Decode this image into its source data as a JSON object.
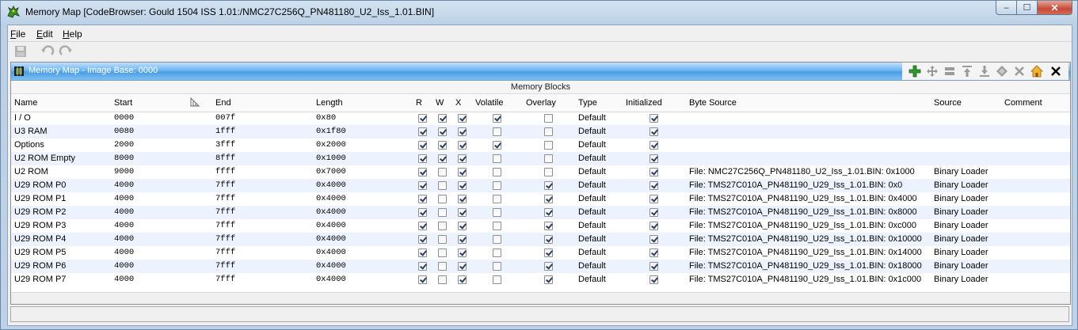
{
  "window": {
    "title": "Memory Map [CodeBrowser: Gould 1504 ISS 1.01:/NMC27C256Q_PN481180_U2_Iss_1.01.BIN]",
    "icon": "ghidra-dragon-icon",
    "buttons": {
      "minimize": "minimize-icon",
      "maximize": "maximize-icon",
      "close": "close-icon"
    }
  },
  "menu": [
    {
      "first": "F",
      "rest": "ile"
    },
    {
      "first": "E",
      "rest": "dit"
    },
    {
      "first": "H",
      "rest": "elp"
    }
  ],
  "toolbar": {
    "icons": [
      "save-icon",
      "undo-icon",
      "redo-icon"
    ]
  },
  "panel": {
    "title": "Memory Map - Image Base: 0000",
    "icon": "memory-chip-icon",
    "actions": [
      "add-block-icon",
      "move-block-icon",
      "split-block-icon",
      "expand-up-icon",
      "expand-down-icon",
      "merge-blocks-icon",
      "delete-block-icon",
      "set-image-base-icon",
      "close-panel-icon"
    ],
    "section_label": "Memory Blocks"
  },
  "table": {
    "columns": [
      "Name",
      "Start",
      "End",
      "Length",
      "R",
      "W",
      "X",
      "Volatile",
      "Overlay",
      "Type",
      "Initialized",
      "Byte Source",
      "Source",
      "Comment"
    ],
    "rows": [
      {
        "name": "I / O",
        "start": "0000",
        "end": "007f",
        "length": "0x80",
        "r": true,
        "w": true,
        "x": true,
        "volatile": true,
        "overlay": false,
        "type": "Default",
        "initialized": true,
        "byte_source": "",
        "source": "",
        "comment": ""
      },
      {
        "name": "U3 RAM",
        "start": "0080",
        "end": "1fff",
        "length": "0x1f80",
        "r": true,
        "w": true,
        "x": true,
        "volatile": false,
        "overlay": false,
        "type": "Default",
        "initialized": true,
        "byte_source": "",
        "source": "",
        "comment": ""
      },
      {
        "name": "Options",
        "start": "2000",
        "end": "3fff",
        "length": "0x2000",
        "r": true,
        "w": true,
        "x": true,
        "volatile": true,
        "overlay": false,
        "type": "Default",
        "initialized": true,
        "byte_source": "",
        "source": "",
        "comment": ""
      },
      {
        "name": "U2 ROM Empty",
        "start": "8000",
        "end": "8fff",
        "length": "0x1000",
        "r": true,
        "w": true,
        "x": true,
        "volatile": false,
        "overlay": false,
        "type": "Default",
        "initialized": true,
        "byte_source": "",
        "source": "",
        "comment": ""
      },
      {
        "name": "U2 ROM",
        "start": "9000",
        "end": "ffff",
        "length": "0x7000",
        "r": true,
        "w": false,
        "x": true,
        "volatile": false,
        "overlay": false,
        "type": "Default",
        "initialized": true,
        "byte_source": "File: NMC27C256Q_PN481180_U2_Iss_1.01.BIN: 0x1000",
        "source": "Binary Loader",
        "comment": ""
      },
      {
        "name": "U29 ROM P0",
        "start": "4000",
        "end": "7fff",
        "length": "0x4000",
        "r": true,
        "w": false,
        "x": true,
        "volatile": false,
        "overlay": true,
        "type": "Default",
        "initialized": true,
        "byte_source": "File: TMS27C010A_PN481190_U29_Iss_1.01.BIN: 0x0",
        "source": "Binary Loader",
        "comment": ""
      },
      {
        "name": "U29 ROM P1",
        "start": "4000",
        "end": "7fff",
        "length": "0x4000",
        "r": true,
        "w": false,
        "x": true,
        "volatile": false,
        "overlay": true,
        "type": "Default",
        "initialized": true,
        "byte_source": "File: TMS27C010A_PN481190_U29_Iss_1.01.BIN: 0x4000",
        "source": "Binary Loader",
        "comment": ""
      },
      {
        "name": "U29 ROM P2",
        "start": "4000",
        "end": "7fff",
        "length": "0x4000",
        "r": true,
        "w": false,
        "x": true,
        "volatile": false,
        "overlay": true,
        "type": "Default",
        "initialized": true,
        "byte_source": "File: TMS27C010A_PN481190_U29_Iss_1.01.BIN: 0x8000",
        "source": "Binary Loader",
        "comment": ""
      },
      {
        "name": "U29 ROM P3",
        "start": "4000",
        "end": "7fff",
        "length": "0x4000",
        "r": true,
        "w": false,
        "x": true,
        "volatile": false,
        "overlay": true,
        "type": "Default",
        "initialized": true,
        "byte_source": "File: TMS27C010A_PN481190_U29_Iss_1.01.BIN: 0xc000",
        "source": "Binary Loader",
        "comment": ""
      },
      {
        "name": "U29 ROM P4",
        "start": "4000",
        "end": "7fff",
        "length": "0x4000",
        "r": true,
        "w": false,
        "x": true,
        "volatile": false,
        "overlay": true,
        "type": "Default",
        "initialized": true,
        "byte_source": "File: TMS27C010A_PN481190_U29_Iss_1.01.BIN: 0x10000",
        "source": "Binary Loader",
        "comment": ""
      },
      {
        "name": "U29 ROM P5",
        "start": "4000",
        "end": "7fff",
        "length": "0x4000",
        "r": true,
        "w": false,
        "x": true,
        "volatile": false,
        "overlay": true,
        "type": "Default",
        "initialized": true,
        "byte_source": "File: TMS27C010A_PN481190_U29_Iss_1.01.BIN: 0x14000",
        "source": "Binary Loader",
        "comment": ""
      },
      {
        "name": "U29 ROM P6",
        "start": "4000",
        "end": "7fff",
        "length": "0x4000",
        "r": true,
        "w": false,
        "x": true,
        "volatile": false,
        "overlay": true,
        "type": "Default",
        "initialized": true,
        "byte_source": "File: TMS27C010A_PN481190_U29_Iss_1.01.BIN: 0x18000",
        "source": "Binary Loader",
        "comment": ""
      },
      {
        "name": "U29 ROM P7",
        "start": "4000",
        "end": "7fff",
        "length": "0x4000",
        "r": true,
        "w": false,
        "x": true,
        "volatile": false,
        "overlay": true,
        "type": "Default",
        "initialized": true,
        "byte_source": "File: TMS27C010A_PN481190_U29_Iss_1.01.BIN: 0x1c000",
        "source": "Binary Loader",
        "comment": ""
      }
    ]
  },
  "colors": {
    "header_blue": "#4b9de6",
    "row_alt": "#edf3fe",
    "add_green": "#2e9a2e"
  }
}
